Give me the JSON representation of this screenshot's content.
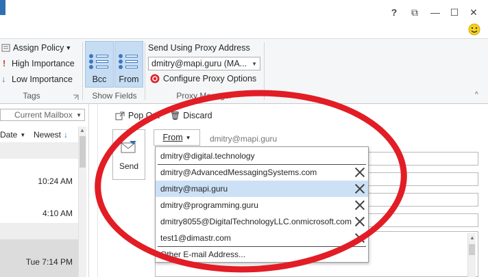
{
  "window": {
    "help_label": "?",
    "restore_ribbon_label": "⧉",
    "minimize_label": "—",
    "maximize_label": "☐",
    "close_label": "✕",
    "smiley_icon": "smiley-icon"
  },
  "ribbon": {
    "tags": {
      "label": "Tags",
      "assign_policy": "Assign Policy",
      "high_importance": "High Importance",
      "low_importance": "Low Importance"
    },
    "show_fields": {
      "label": "Show Fields",
      "bcc": "Bcc",
      "from": "From"
    },
    "proxy_manager": {
      "label": "Proxy Manager",
      "heading": "Send Using Proxy Address",
      "selected": "dmitry@mapi.guru (MA...",
      "configure": "Configure Proxy Options"
    }
  },
  "left_pane": {
    "mailbox_scope": "Current Mailbox",
    "sort_field": "Date",
    "sort_order": "Newest",
    "times": [
      "10:24 AM",
      "4:10 AM",
      "Tue 7:14 PM"
    ]
  },
  "compose": {
    "pop_out": "Pop Out",
    "discard": "Discard",
    "send": "Send",
    "from_label": "From",
    "from_value": "dmitry@mapi.guru",
    "from_options": [
      {
        "address": "dmitry@digital.technology",
        "removable": false
      },
      {
        "address": "dmitry@AdvancedMessagingSystems.com",
        "removable": true
      },
      {
        "address": "dmitry@mapi.guru",
        "removable": true,
        "selected": true
      },
      {
        "address": "dmitry@programming.guru",
        "removable": true
      },
      {
        "address": "dmitry8055@DigitalTechnologyLLC.onmicrosoft.com",
        "removable": true
      },
      {
        "address": "test1@dimastr.com",
        "removable": true
      }
    ],
    "other_address": "Other E-mail Address..."
  },
  "colors": {
    "accent": "#2f6fb3",
    "selection": "#cde1f6",
    "annotation": "#e21d25",
    "high_importance": "#d13438",
    "low_importance": "#2f6fb3"
  }
}
